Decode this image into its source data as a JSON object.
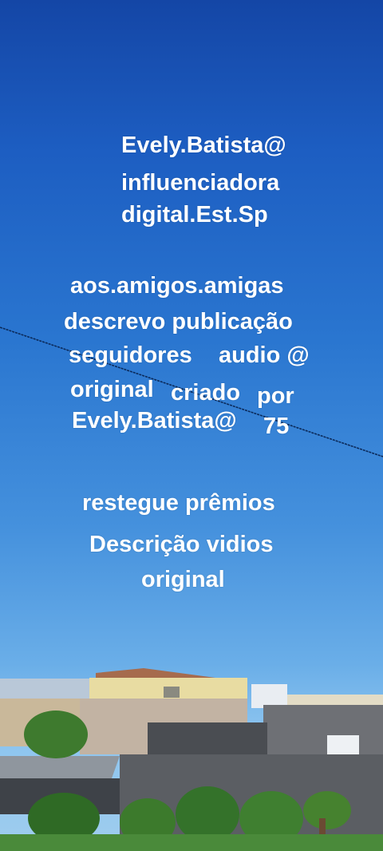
{
  "overlay": {
    "line1": "Evely.Batista@",
    "line2": "influenciadora",
    "line3": "digital.Est.Sp",
    "line4": "aos.amigos.amigas",
    "line5": "descrevo publicação",
    "line6a": "seguidores",
    "line6b": "audio @",
    "line7a": "original",
    "line7b": "criado",
    "line7c": "por",
    "line8a": "Evely.Batista@",
    "line8b": "75",
    "line9": "restegue prêmios",
    "line10": "Descrição vidios",
    "line11": "original"
  },
  "colors": {
    "sky_top": "#1446a6",
    "sky_bottom": "#9fcdee",
    "text": "#ffffff"
  }
}
